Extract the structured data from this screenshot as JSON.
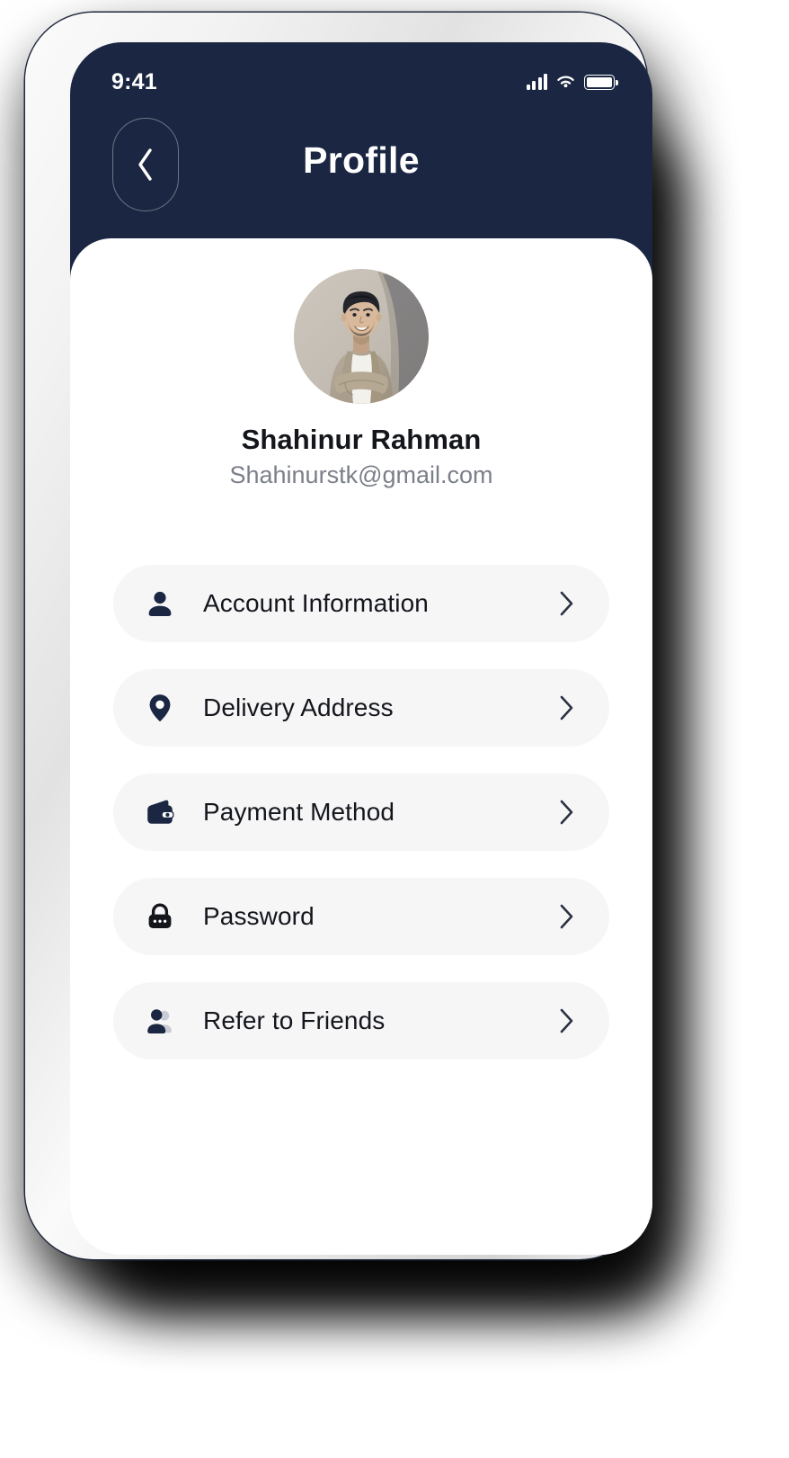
{
  "theme": {
    "header_bg": "#1b2742",
    "card_bg": "#ffffff",
    "row_bg": "#f6f6f7",
    "icon_color": "#1b2742",
    "text_primary": "#14161c",
    "text_secondary": "#7b7f88",
    "status_text": "#ffffff"
  },
  "status_bar": {
    "time": "9:41",
    "signal_icon": "cellular-signal-icon",
    "wifi_icon": "wifi-icon",
    "battery_icon": "battery-full-icon"
  },
  "nav": {
    "title": "Profile",
    "back_icon": "chevron-left-icon"
  },
  "profile": {
    "avatar_alt": "user-avatar-photo",
    "name": "Shahinur Rahman",
    "email": "Shahinurstk@gmail.com"
  },
  "menu": {
    "items": [
      {
        "label": "Account Information",
        "icon": "person-icon",
        "chevron": "chevron-right-icon"
      },
      {
        "label": "Delivery Address",
        "icon": "location-pin-icon",
        "chevron": "chevron-right-icon"
      },
      {
        "label": "Payment Method",
        "icon": "wallet-icon",
        "chevron": "chevron-right-icon"
      },
      {
        "label": "Password",
        "icon": "lock-icon",
        "chevron": "chevron-right-icon"
      },
      {
        "label": "Refer to Friends",
        "icon": "people-icon",
        "chevron": "chevron-right-icon"
      }
    ]
  }
}
